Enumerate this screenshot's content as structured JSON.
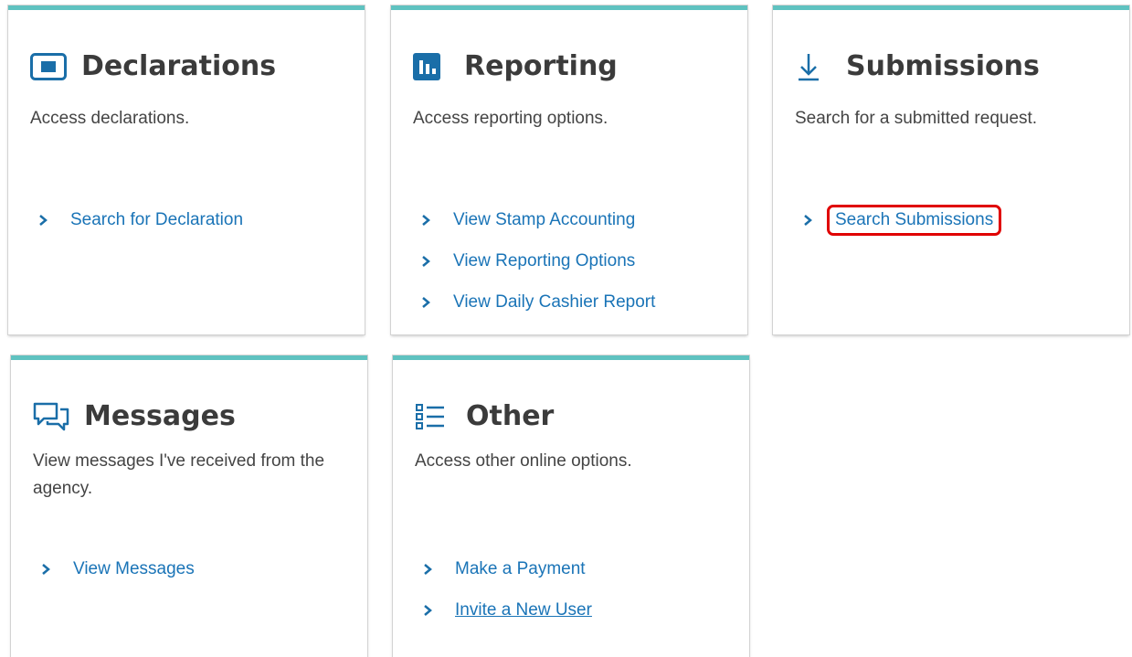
{
  "cards": [
    {
      "title": "Declarations",
      "icon": "window-icon",
      "description": "Access declarations.",
      "links": [
        {
          "label": "Search for Declaration"
        }
      ]
    },
    {
      "title": "Reporting",
      "icon": "bar-chart-icon",
      "description": "Access reporting options.",
      "links": [
        {
          "label": "View Stamp Accounting"
        },
        {
          "label": "View Reporting Options"
        },
        {
          "label": "View Daily Cashier Report"
        }
      ]
    },
    {
      "title": "Submissions",
      "icon": "download-arrow-icon",
      "description": "Search for a submitted request.",
      "links": [
        {
          "label": "Search Submissions",
          "highlighted": true
        }
      ]
    },
    {
      "title": "Messages",
      "icon": "chat-bubbles-icon",
      "description": "View messages I've received from the agency.",
      "links": [
        {
          "label": "View Messages"
        }
      ]
    },
    {
      "title": "Other",
      "icon": "list-icon",
      "description": "Access other online options.",
      "links": [
        {
          "label": "Make a Payment"
        },
        {
          "label": "Invite a New User",
          "underlined": true
        }
      ]
    }
  ],
  "colors": {
    "accent_bar": "#5fc2c0",
    "link": "#1a74b7",
    "icon_blue": "#1a6ea8",
    "highlight_border": "#e00000",
    "title_text": "#3b3b3b"
  }
}
